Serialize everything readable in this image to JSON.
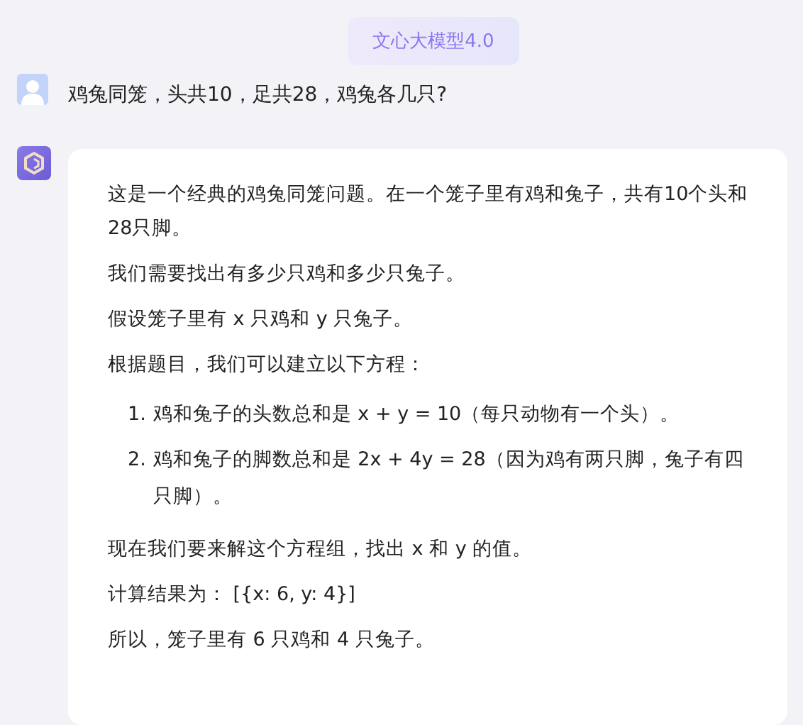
{
  "model_badge": "文心大模型4.0",
  "question": "鸡兔同笼，头共10，足共28，鸡兔各几只?",
  "answer": [
    {
      "kind": "paragraph",
      "text": "这是一个经典的鸡兔同笼问题。在一个笼子里有鸡和兔子，共有10个头和28只脚。"
    },
    {
      "kind": "paragraph",
      "text": "我们需要找出有多少只鸡和多少只兔子。"
    },
    {
      "kind": "paragraph",
      "text": "假设笼子里有 x 只鸡和 y 只兔子。"
    },
    {
      "kind": "paragraph",
      "text": "根据题目，我们可以建立以下方程："
    },
    {
      "kind": "list",
      "items": [
        {
          "number": "1.",
          "text": "鸡和兔子的头数总和是 x + y = 10（每只动物有一个头）。"
        },
        {
          "number": "2.",
          "text": "鸡和兔子的脚数总和是 2x + 4y = 28（因为鸡有两只脚，兔子有四只脚）。"
        }
      ]
    },
    {
      "kind": "paragraph",
      "text": "现在我们要来解这个方程组，找出 x 和 y 的值。"
    },
    {
      "kind": "paragraph",
      "text": "计算结果为：  [{x: 6, y: 4}]"
    },
    {
      "kind": "paragraph",
      "text": "所以，笼子里有 6 只鸡和 4 只兔子。"
    }
  ]
}
